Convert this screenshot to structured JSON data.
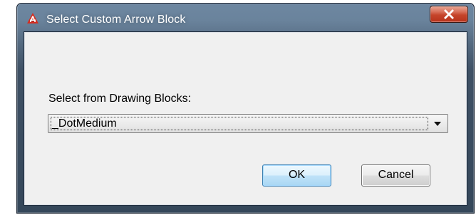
{
  "window": {
    "title": "Select Custom Arrow Block",
    "app_icon": "autocad-logo-icon",
    "close_icon": "close-icon",
    "colors": {
      "title_bar": "#5b7289",
      "close_button": "#c7452b",
      "client_background": "#f0f0f0",
      "default_button_border": "#3c7fb1"
    }
  },
  "form": {
    "prompt_label": "Select from Drawing Blocks:",
    "block_select": {
      "selected_value": "_DotMedium",
      "icon": "chevron-down-icon"
    }
  },
  "buttons": {
    "ok_label": "OK",
    "cancel_label": "Cancel"
  }
}
